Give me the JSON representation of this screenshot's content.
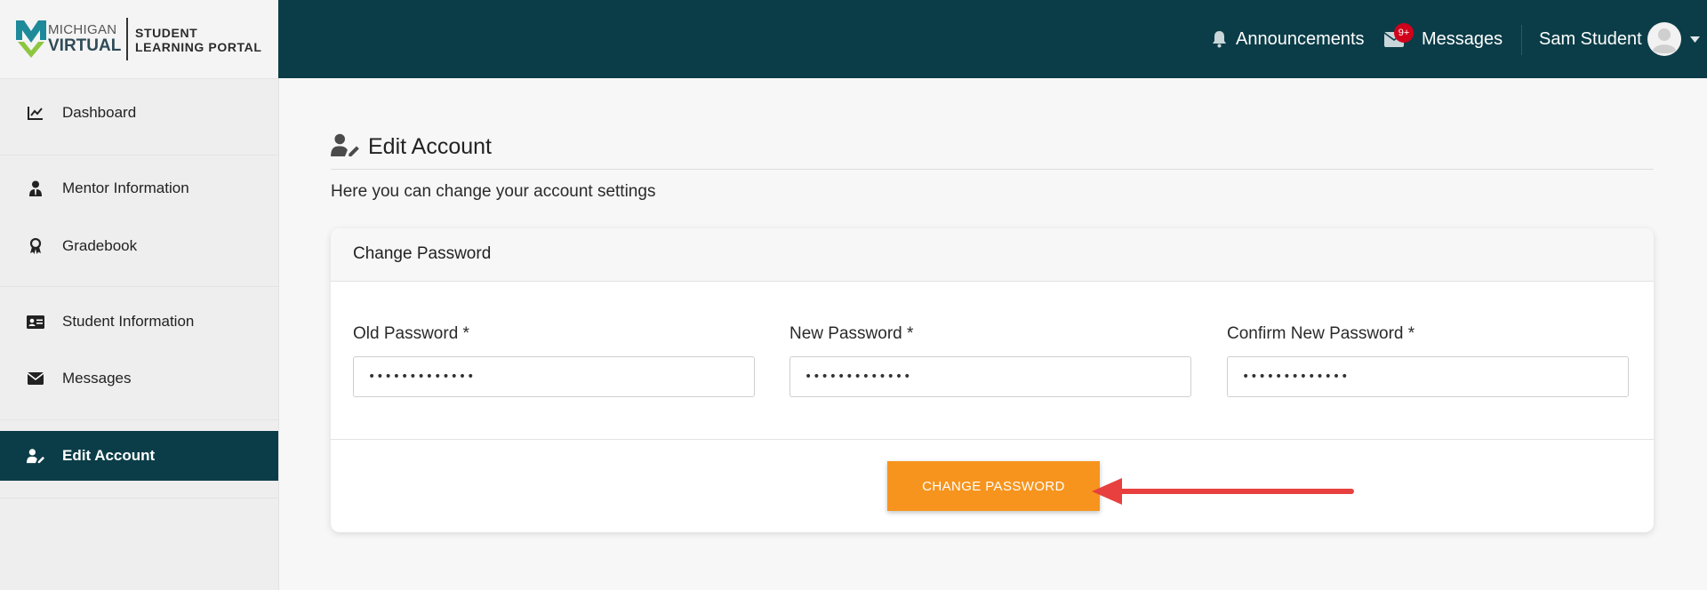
{
  "logo": {
    "brand_line1": "MICHIGAN",
    "brand_line2": "VIRTUAL",
    "portal_line1": "STUDENT",
    "portal_line2": "LEARNING PORTAL"
  },
  "sidebar": {
    "items": [
      {
        "label": "Dashboard",
        "icon": "chart-line-icon"
      },
      {
        "label": "Mentor Information",
        "icon": "user-tie-icon"
      },
      {
        "label": "Gradebook",
        "icon": "award-icon"
      },
      {
        "label": "Student Information",
        "icon": "id-card-icon"
      },
      {
        "label": "Messages",
        "icon": "envelope-icon"
      },
      {
        "label": "Edit Account",
        "icon": "user-edit-icon",
        "active": true
      }
    ]
  },
  "topbar": {
    "announcements_label": "Announcements",
    "messages_label": "Messages",
    "messages_badge": "9+",
    "user_name": "Sam Student"
  },
  "page": {
    "title": "Edit Account",
    "subtitle": "Here you can change your account settings"
  },
  "change_password": {
    "card_title": "Change Password",
    "old_label": "Old Password *",
    "new_label": "New Password *",
    "confirm_label": "Confirm New Password *",
    "old_value": "•••••••••••••",
    "new_value": "•••••••••••••",
    "confirm_value": "•••••••••••••",
    "button_label": "CHANGE PASSWORD"
  },
  "colors": {
    "primary_dark": "#0b3d48",
    "accent_orange": "#f7941d",
    "badge_red": "#d0021b",
    "arrow_red": "#e8403e",
    "logo_teal": "#1d8a9a",
    "logo_green": "#8dc63f"
  }
}
